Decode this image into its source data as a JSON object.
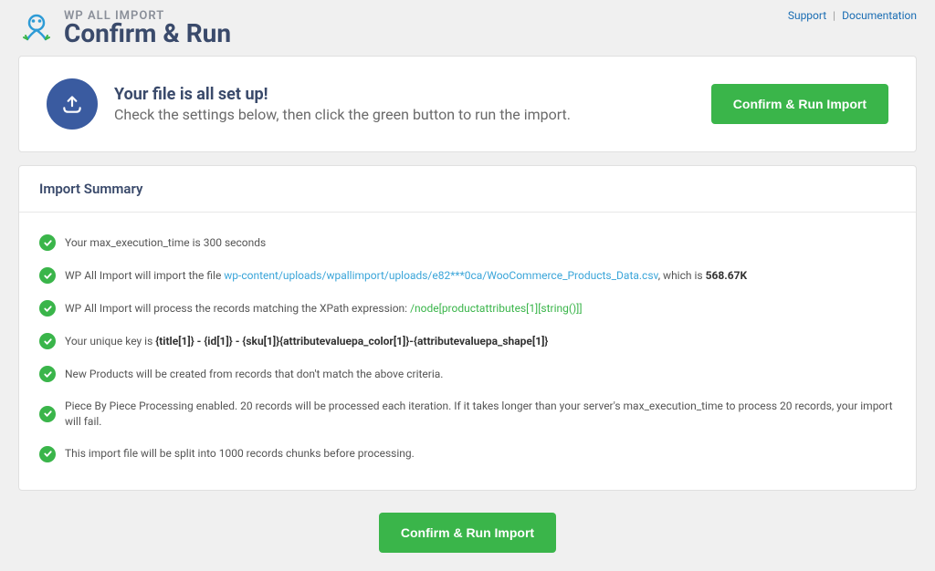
{
  "header": {
    "brand_subtitle": "WP ALL IMPORT",
    "brand_title": "Confirm & Run",
    "links": {
      "support": "Support",
      "documentation": "Documentation"
    }
  },
  "setup": {
    "title": "Your file is all set up!",
    "subtitle": "Check the settings below, then click the green button to run the import.",
    "button": "Confirm & Run Import"
  },
  "summary": {
    "heading": "Import Summary",
    "items": {
      "exec_time": {
        "prefix": "Your max_execution_time is ",
        "value": "300 seconds"
      },
      "file": {
        "prefix": "WP All Import will import the file ",
        "path": "wp-content/uploads/wpallimport/uploads/e82***0ca/WooCommerce_Products_Data.csv",
        "mid": ", which is ",
        "size": "568.67K"
      },
      "xpath": {
        "prefix": "WP All Import will process the records matching the XPath expression: ",
        "expr": "/node[productattributes[1][string()]]"
      },
      "unique_key": {
        "prefix": "Your unique key is ",
        "value": "{title[1]} - {id[1]} - {sku[1]}{attributevaluepa_color[1]}-{attributevaluepa_shape[1]}"
      },
      "new_products": "New Products will be created from records that don't match the above criteria.",
      "piece": "Piece By Piece Processing enabled. 20 records will be processed each iteration. If it takes longer than your server's max_execution_time to process 20 records, your import will fail.",
      "split": "This import file will be split into 1000 records chunks before processing."
    }
  },
  "footer": {
    "button": "Confirm & Run Import"
  }
}
